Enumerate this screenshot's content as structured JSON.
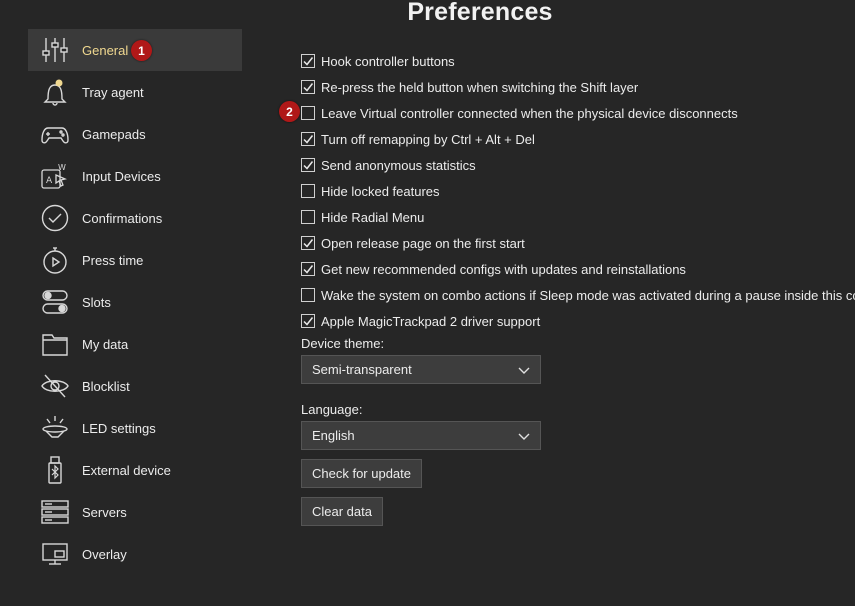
{
  "header": {
    "title": "Preferences"
  },
  "accent_color": "#f0d890",
  "badge_color": "#b01818",
  "sidebar": {
    "items": [
      {
        "label": "General",
        "icon": "sliders-icon",
        "active": true
      },
      {
        "label": "Tray agent",
        "icon": "bell-icon"
      },
      {
        "label": "Gamepads",
        "icon": "gamepad-icon"
      },
      {
        "label": "Input Devices",
        "icon": "keyboard-mouse-icon"
      },
      {
        "label": "Confirmations",
        "icon": "checkmark-circle-icon"
      },
      {
        "label": "Press time",
        "icon": "stopwatch-icon"
      },
      {
        "label": "Slots",
        "icon": "toggles-icon"
      },
      {
        "label": "My data",
        "icon": "folder-icon"
      },
      {
        "label": "Blocklist",
        "icon": "hidden-eye-icon"
      },
      {
        "label": "LED settings",
        "icon": "lamp-icon"
      },
      {
        "label": "External device",
        "icon": "usb-bluetooth-icon"
      },
      {
        "label": "Servers",
        "icon": "server-icon"
      },
      {
        "label": "Overlay",
        "icon": "monitor-icon"
      }
    ]
  },
  "badges": {
    "one": "1",
    "two": "2"
  },
  "options": [
    {
      "label": "Hook controller buttons",
      "checked": true
    },
    {
      "label": "Re-press the held button when switching the Shift layer",
      "checked": true
    },
    {
      "label": "Leave Virtual controller connected when the physical device disconnects",
      "checked": false
    },
    {
      "label": "Turn off remapping by Ctrl + Alt + Del",
      "checked": true
    },
    {
      "label": "Send anonymous statistics",
      "checked": true
    },
    {
      "label": "Hide locked features",
      "checked": false
    },
    {
      "label": "Hide Radial Menu",
      "checked": false
    },
    {
      "label": "Open release page on the first start",
      "checked": true
    },
    {
      "label": "Get new recommended configs with updates and reinstallations",
      "checked": true
    },
    {
      "label": "Wake the system on combo actions if Sleep mode was activated during a pause inside this combo",
      "checked": false
    },
    {
      "label": "Apple MagicTrackpad 2 driver support",
      "checked": true
    }
  ],
  "device_theme": {
    "label": "Device theme:",
    "value": "Semi-transparent"
  },
  "language": {
    "label": "Language:",
    "value": "English"
  },
  "buttons": {
    "check_update": "Check for update",
    "clear_data": "Clear data"
  }
}
